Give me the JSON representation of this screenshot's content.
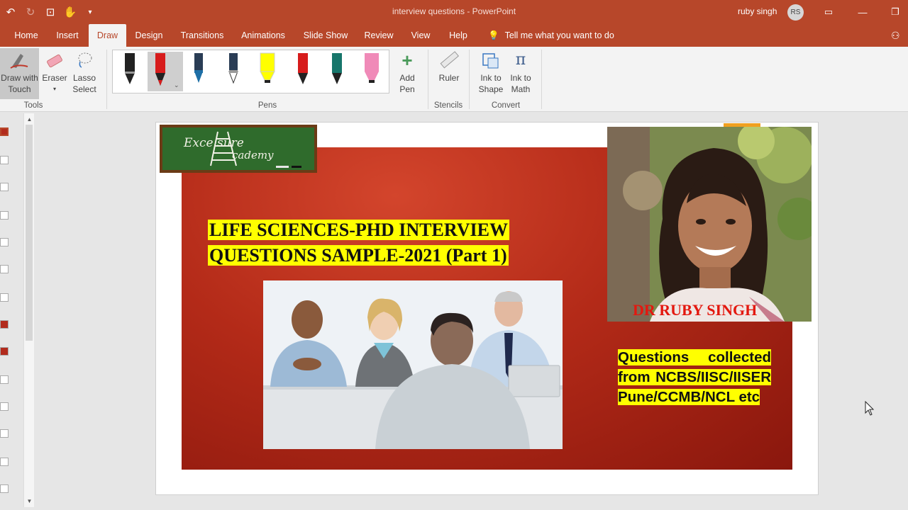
{
  "window": {
    "title": "interview questions  -  PowerPoint",
    "user_name": "ruby singh",
    "user_initials": "RS"
  },
  "tabs": [
    "Home",
    "Insert",
    "Draw",
    "Design",
    "Transitions",
    "Animations",
    "Slide Show",
    "Review",
    "View",
    "Help"
  ],
  "active_tab": "Draw",
  "tell_me": "Tell me what you want to do",
  "ribbon": {
    "tools": {
      "group_label": "Tools",
      "draw_with_touch": "Draw with Touch",
      "eraser": "Eraser",
      "lasso_select": "Lasso Select"
    },
    "pens": {
      "group_label": "Pens",
      "add_pen": "Add Pen",
      "colors": [
        "#111111",
        "#d71c1c",
        "#1e6fa6",
        "#9a9a9a",
        "#ffff00",
        "#d71c1c",
        "#17766b",
        "#f08ab8"
      ]
    },
    "stencils": {
      "group_label": "Stencils",
      "ruler": "Ruler"
    },
    "convert": {
      "group_label": "Convert",
      "ink_to_shape": "Ink to Shape",
      "ink_to_math": "Ink to Math"
    }
  },
  "slide": {
    "logo_text_1": "Exce sure",
    "logo_text_2": "cademy",
    "title_line_1": "LIFE SCIENCES-PHD INTERVIEW",
    "title_line_2": "QUESTIONS SAMPLE-2021 (Part 1)",
    "presenter_name": "DR RUBY SINGH",
    "questions_text": "Questions collected from NCBS/IISC/IISER Pune/CCMB/NCL etc"
  },
  "colors": {
    "accent": "#b7472a",
    "highlight": "#ffff00",
    "slide_red": "#b32a18",
    "name_red": "#e3180f"
  }
}
